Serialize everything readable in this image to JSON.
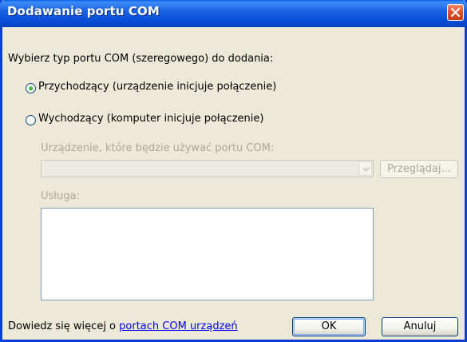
{
  "window": {
    "title": "Dodawanie portu COM"
  },
  "dialog": {
    "prompt": "Wybierz typ portu COM (szeregowego) do dodania:",
    "radio_incoming": "Przychodzący (urządzenie inicjuje połączenie)",
    "radio_incoming_selected": true,
    "radio_outgoing": "Wychodzący (komputer inicjuje połączenie)",
    "radio_outgoing_selected": false,
    "device_label": "Urządzenie, które będzie używać portu COM:",
    "device_value": "",
    "browse_label": "Przeglądaj...",
    "service_label": "Usługa:",
    "service_value": ""
  },
  "footer": {
    "help_prefix": "Dowiedz się więcej o ",
    "help_link": "portach COM urządzeń",
    "ok_label": "OK",
    "cancel_label": "Anuluj"
  },
  "icons": {
    "close": "close-icon",
    "dropdown": "chevron-down-icon"
  },
  "colors": {
    "titlebar": "#0a4fd8",
    "dialog_bg": "#ece9d8",
    "close_button": "#e0532e",
    "disabled_text": "#aca899",
    "link": "#0000ee"
  }
}
